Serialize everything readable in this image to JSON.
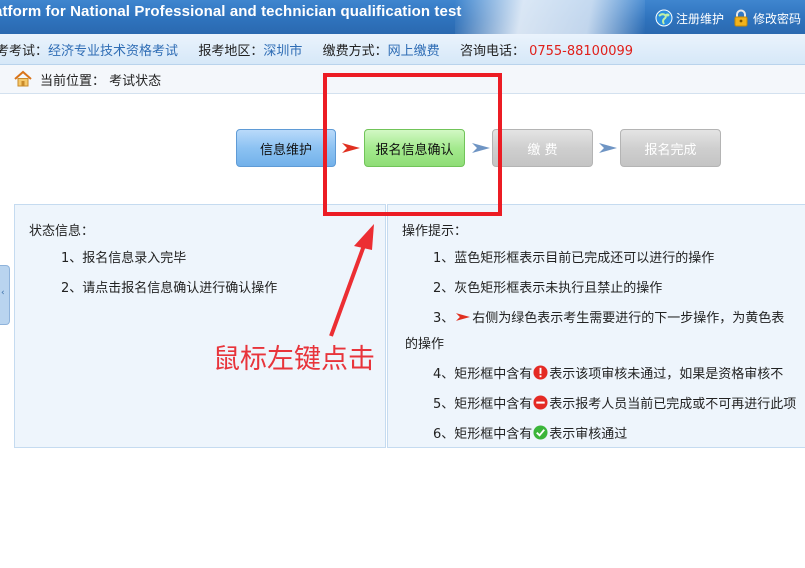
{
  "header": {
    "title": "atform for National Professional and technician qualification test",
    "register_label": "注册维护",
    "password_label": "修改密码"
  },
  "infobar": {
    "exam_label": "考考试：",
    "exam_value": "经济专业技术资格考试",
    "region_label": "报考地区：",
    "region_value": "深圳市",
    "pay_label": "缴费方式：",
    "pay_value": "网上缴费",
    "phone_label": "咨询电话：",
    "phone_value": "0755-88100099"
  },
  "breadcrumb": {
    "label": "当前位置：",
    "current": "考试状态"
  },
  "steps": [
    {
      "label": "信息维护",
      "state": "done"
    },
    {
      "label": "报名信息确认",
      "state": "next"
    },
    {
      "label": "缴 费",
      "state": "disabled"
    },
    {
      "label": "报名完成",
      "state": "disabled"
    }
  ],
  "status_panel": {
    "title": "状态信息：",
    "lines": [
      "1、报名信息录入完毕",
      "2、请点击报名信息确认进行确认操作"
    ]
  },
  "tips_panel": {
    "title": "操作提示：",
    "line1": "1、蓝色矩形框表示目前已完成还可以进行的操作",
    "line2": "2、灰色矩形框表示未执行且禁止的操作",
    "line3_prefix": "3、",
    "line3_text": "右侧为绿色表示考生需要进行的下一步操作，为黄色表",
    "line3_cont": "的操作",
    "line4_prefix": "4、矩形框中含有",
    "line4_suffix": "表示该项审核未通过，如果是资格审核不",
    "line5_prefix": "5、矩形框中含有",
    "line5_suffix": "表示报考人员当前已完成或不可再进行此项",
    "line6_prefix": "6、矩形框中含有",
    "line6_suffix": "表示审核通过"
  },
  "annotation": {
    "text": "鼠标左键点击"
  },
  "colors": {
    "header_blue": "#2f73bd",
    "link_blue": "#2f6db5",
    "phone_red": "#e0201a",
    "annotation_red": "#ec1c24",
    "step_next_green": "#a4ea8e",
    "step_done_blue": "#8cc2f2",
    "step_disabled_gray": "#cfcfcf"
  },
  "icons": [
    "globe-icon",
    "lock-icon",
    "home-icon",
    "red-arrow-icon",
    "step-arrow-icon",
    "error-badge-icon",
    "minus-badge-icon",
    "check-badge-icon"
  ]
}
